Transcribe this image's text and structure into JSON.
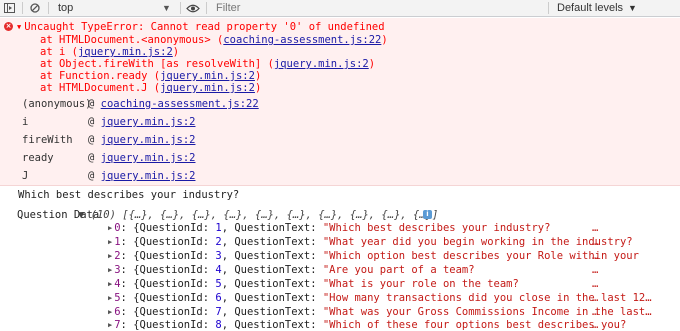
{
  "toolbar": {
    "context": "top",
    "filter_placeholder": "Filter",
    "levels": "Default levels"
  },
  "error": {
    "message": "Uncaught TypeError: Cannot read property '0' of undefined",
    "stack": [
      {
        "prefix": "at HTMLDocument.<anonymous> (",
        "link": "coaching-assessment.js:22",
        "suffix": ")"
      },
      {
        "prefix": "at i (",
        "link": "jquery.min.js:2",
        "suffix": ")"
      },
      {
        "prefix": "at Object.fireWith [as resolveWith] (",
        "link": "jquery.min.js:2",
        "suffix": ")"
      },
      {
        "prefix": "at Function.ready (",
        "link": "jquery.min.js:2",
        "suffix": ")"
      },
      {
        "prefix": "at HTMLDocument.J (",
        "link": "jquery.min.js:2",
        "suffix": ")"
      }
    ],
    "frames": [
      {
        "name": "(anonymous)",
        "at": "@",
        "link": "coaching-assessment.js:22"
      },
      {
        "name": "i",
        "at": "@",
        "link": "jquery.min.js:2"
      },
      {
        "name": "fireWith",
        "at": "@",
        "link": "jquery.min.js:2"
      },
      {
        "name": "ready",
        "at": "@",
        "link": "jquery.min.js:2"
      },
      {
        "name": "J",
        "at": "@",
        "link": "jquery.min.js:2"
      }
    ]
  },
  "log_line": "Which best describes your industry?",
  "question_data": {
    "label": "Question Data",
    "summary": "▼ (10) [{…}, {…}, {…}, {…}, {…}, {…}, {…}, {…}, {…}, {…}]",
    "info": "i",
    "rows": [
      {
        "index": "0",
        "id": "1",
        "text": "\"Which best describes your industry?"
      },
      {
        "index": "1",
        "id": "2",
        "text": "\"What year did you begin working in the industry?"
      },
      {
        "index": "2",
        "id": "3",
        "text": "\"Which option best describes your Role within your"
      },
      {
        "index": "3",
        "id": "4",
        "text": "\"Are you part of a team?"
      },
      {
        "index": "4",
        "id": "5",
        "text": "\"What is your role on the team?"
      },
      {
        "index": "5",
        "id": "6",
        "text": "\"How many transactions did you close in the last 12…"
      },
      {
        "index": "6",
        "id": "7",
        "text": "\"What was your Gross Commissions Income in the last…"
      },
      {
        "index": "7",
        "id": "8",
        "text": "\"Which of these four options best describes you?"
      }
    ]
  }
}
